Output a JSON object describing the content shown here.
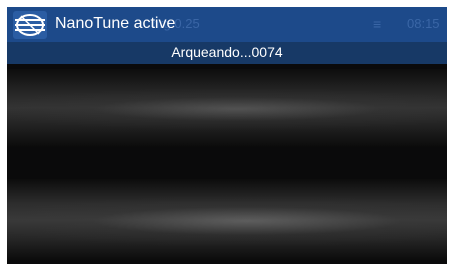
{
  "app": {
    "title": "NanoTune active",
    "icon": "nanotune-logo-icon"
  },
  "status_bar": {
    "left_text": "nrg 0.25",
    "time": "08:15",
    "wifi_icon": "wifi-icon"
  },
  "notification": {
    "text": "Arqueando...0074"
  },
  "colors": {
    "topbar": "#1d4a8a",
    "subbar": "#173966",
    "feed_background": "#0a0a0b"
  }
}
